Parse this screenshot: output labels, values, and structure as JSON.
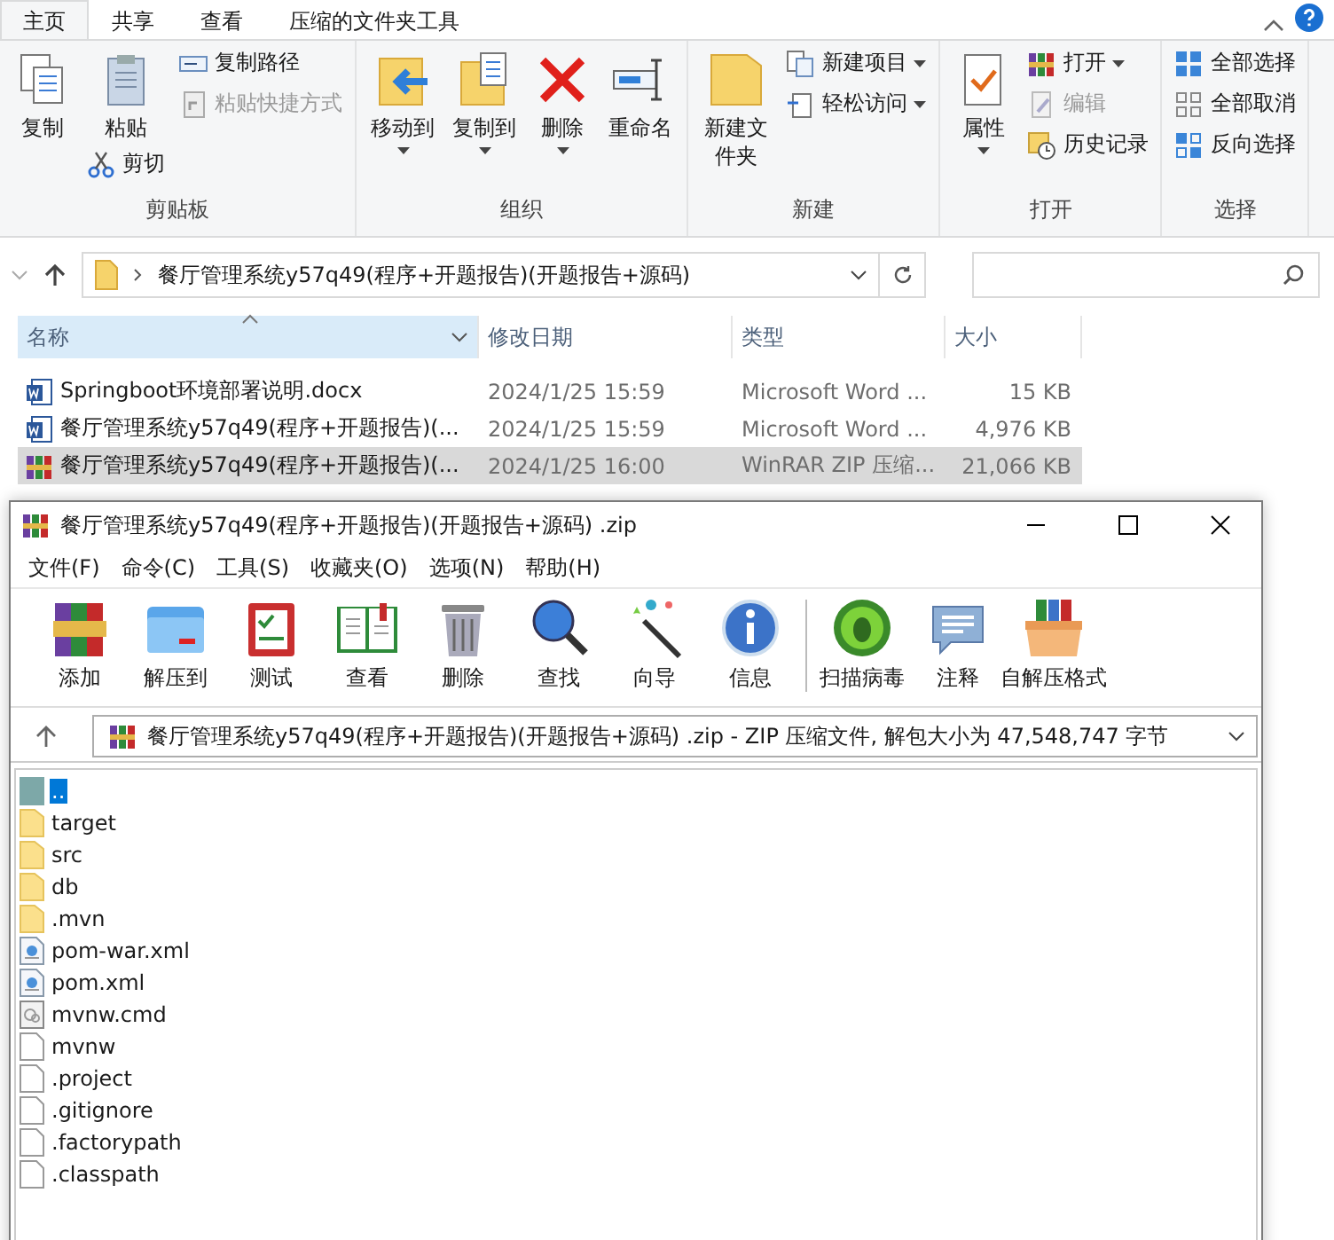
{
  "explorer": {
    "tabs": [
      {
        "label": "主页",
        "selected": true
      },
      {
        "label": "共享",
        "selected": false
      },
      {
        "label": "查看",
        "selected": false
      },
      {
        "label": "压缩的文件夹工具",
        "selected": false
      }
    ],
    "ribbon_groups": [
      {
        "label": "剪贴板",
        "columns": [
          [
            {
              "kind": "large",
              "label": "复制",
              "disabled": false,
              "dropdown": false
            }
          ],
          [
            {
              "kind": "large",
              "label": "粘贴",
              "disabled": false,
              "dropdown": false
            },
            {
              "kind": "small",
              "label": "剪切",
              "disabled": false,
              "dropdown": false
            }
          ],
          [
            {
              "kind": "small",
              "label": "复制路径",
              "disabled": false,
              "dropdown": false
            },
            {
              "kind": "small",
              "label": "粘贴快捷方式",
              "disabled": true,
              "dropdown": false
            }
          ]
        ]
      },
      {
        "label": "组织",
        "columns": [
          [
            {
              "kind": "large",
              "label": "移动到",
              "disabled": false,
              "dropdown": true
            }
          ],
          [
            {
              "kind": "large",
              "label": "复制到",
              "disabled": false,
              "dropdown": true
            }
          ],
          [
            {
              "kind": "large",
              "label": "删除",
              "disabled": false,
              "dropdown": true
            }
          ],
          [
            {
              "kind": "large",
              "label": "重命名",
              "disabled": false,
              "dropdown": false
            }
          ]
        ]
      },
      {
        "label": "新建",
        "columns": [
          [
            {
              "kind": "large",
              "label": "新建文件夹",
              "disabled": false,
              "dropdown": false
            }
          ],
          [
            {
              "kind": "small",
              "label": "新建项目",
              "disabled": false,
              "dropdown": true
            },
            {
              "kind": "small",
              "label": "轻松访问",
              "disabled": false,
              "dropdown": true
            }
          ]
        ]
      },
      {
        "label": "打开",
        "columns": [
          [
            {
              "kind": "large",
              "label": "属性",
              "disabled": false,
              "dropdown": true
            }
          ],
          [
            {
              "kind": "small",
              "label": "打开",
              "disabled": false,
              "dropdown": true
            },
            {
              "kind": "small",
              "label": "编辑",
              "disabled": true,
              "dropdown": false
            },
            {
              "kind": "small",
              "label": "历史记录",
              "disabled": false,
              "dropdown": false
            }
          ]
        ]
      },
      {
        "label": "选择",
        "columns": [
          [
            {
              "kind": "small",
              "label": "全部选择",
              "disabled": false,
              "dropdown": false
            },
            {
              "kind": "small",
              "label": "全部取消",
              "disabled": false,
              "dropdown": false
            },
            {
              "kind": "small",
              "label": "反向选择",
              "disabled": false,
              "dropdown": false
            }
          ]
        ]
      }
    ],
    "address": {
      "path": "餐厅管理系统y57q49(程序+开题报告)(开题报告+源码)"
    },
    "columns": [
      {
        "label": "名称",
        "selected": true
      },
      {
        "label": "修改日期",
        "selected": false
      },
      {
        "label": "类型",
        "selected": false
      },
      {
        "label": "大小",
        "selected": false
      }
    ],
    "rows": [
      {
        "kind": "word",
        "name": "Springboot环境部署说明.docx",
        "date": "2024/1/25 15:59",
        "file_type": "Microsoft Word ...",
        "size": "15 KB",
        "selected": false
      },
      {
        "kind": "word",
        "name": "餐厅管理系统y57q49(程序+开题报告)(...",
        "date": "2024/1/25 15:59",
        "file_type": "Microsoft Word ...",
        "size": "4,976 KB",
        "selected": false
      },
      {
        "kind": "rar",
        "name": "餐厅管理系统y57q49(程序+开题报告)(...",
        "date": "2024/1/25 16:00",
        "file_type": "WinRAR ZIP 压缩...",
        "size": "21,066 KB",
        "selected": true
      }
    ]
  },
  "winrar": {
    "title": "餐厅管理系统y57q49(程序+开题报告)(开题报告+源码) .zip",
    "menu": [
      "文件(F)",
      "命令(C)",
      "工具(S)",
      "收藏夹(O)",
      "选项(N)",
      "帮助(H)"
    ],
    "toolbar_groups": [
      [
        "添加",
        "解压到",
        "测试",
        "查看",
        "删除",
        "查找",
        "向导",
        "信息"
      ],
      [
        "扫描病毒",
        "注释",
        "自解压格式"
      ]
    ],
    "address": "餐厅管理系统y57q49(程序+开题报告)(开题报告+源码) .zip - ZIP 压缩文件, 解包大小为 47,548,747 字节",
    "entries": [
      {
        "kind": "up",
        "name": "..",
        "selected": true
      },
      {
        "kind": "folder",
        "name": "target",
        "selected": false
      },
      {
        "kind": "folder",
        "name": "src",
        "selected": false
      },
      {
        "kind": "folder",
        "name": "db",
        "selected": false
      },
      {
        "kind": "folder",
        "name": ".mvn",
        "selected": false
      },
      {
        "kind": "xml",
        "name": "pom-war.xml",
        "selected": false
      },
      {
        "kind": "xml",
        "name": "pom.xml",
        "selected": false
      },
      {
        "kind": "cmd",
        "name": "mvnw.cmd",
        "selected": false
      },
      {
        "kind": "file",
        "name": "mvnw",
        "selected": false
      },
      {
        "kind": "file",
        "name": ".project",
        "selected": false
      },
      {
        "kind": "file",
        "name": ".gitignore",
        "selected": false
      },
      {
        "kind": "file",
        "name": ".factorypath",
        "selected": false
      },
      {
        "kind": "file",
        "name": ".classpath",
        "selected": false
      }
    ]
  }
}
